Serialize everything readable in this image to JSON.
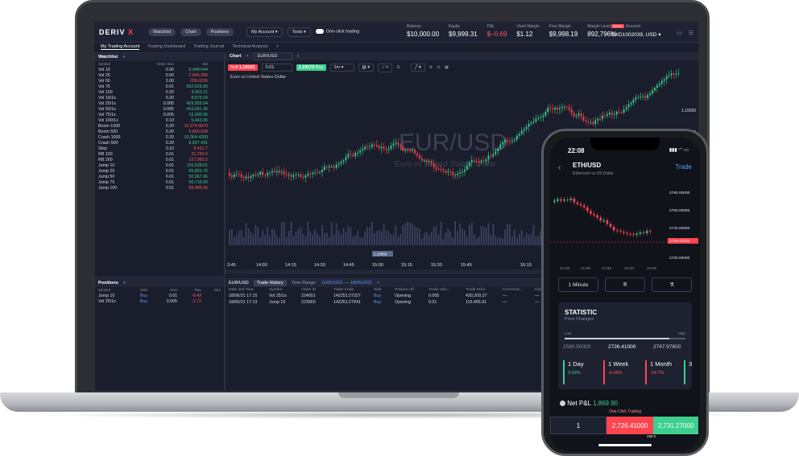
{
  "laptop": {
    "logo_main": "DERIV",
    "logo_x": "X",
    "nav_pills": [
      "Watchlist",
      "Chart",
      "Positions"
    ],
    "account_dd": "My Account",
    "tools_dd": "Tools",
    "one_click": "One-click trading",
    "stats": [
      {
        "label": "Balance",
        "value": "$10,000.00",
        "neg": false
      },
      {
        "label": "Equity",
        "value": "$9,999.31",
        "neg": false
      },
      {
        "label": "P&L",
        "value": "$−0.69",
        "neg": true
      },
      {
        "label": "Used Margin",
        "value": "$1.12",
        "neg": false
      },
      {
        "label": "Free Margin",
        "value": "$9,998.19",
        "neg": false
      },
      {
        "label": "Margin Level, %",
        "value": "892,796%",
        "neg": false
      }
    ],
    "account": {
      "badge": "DEMO",
      "label": "Account",
      "value": "DXD1002039, USD"
    },
    "tabs": [
      "My Trading Account",
      "Trading Dashboard",
      "Trading Journal",
      "Technical Analysis"
    ],
    "watchlist": {
      "title": "Watchlist",
      "cols": [
        "Symbol",
        "Order Size",
        "Bid"
      ],
      "rows": [
        {
          "s": "Vol 10",
          "o": "0.30",
          "b": "6,448.644",
          "c": "pos"
        },
        {
          "s": "Vol 25",
          "o": "0.50",
          "b": "2,646.286",
          "c": "neg"
        },
        {
          "s": "Vol 50",
          "o": "3.00",
          "b": "209.0235",
          "c": "neg"
        },
        {
          "s": "Vol 75",
          "o": "0.01",
          "b": "592,525.83",
          "c": "pos"
        },
        {
          "s": "Vol 100",
          "o": "0.20",
          "b": "4,363.21",
          "c": "pos"
        },
        {
          "s": "Vol 10/1s",
          "o": "0.20",
          "b": "8,875.54",
          "c": "pos"
        },
        {
          "s": "Vol 25/1s",
          "o": "0.005",
          "b": "429,959.04",
          "c": "pos"
        },
        {
          "s": "Vol 50/1s",
          "o": "0.005",
          "b": "419,091.36",
          "c": "pos"
        },
        {
          "s": "Vol 75/1s",
          "o": "0.005",
          "b": "15,390.95",
          "c": "pos"
        },
        {
          "s": "Vol 100/1s",
          "o": "0.10",
          "b": "5,443.96",
          "c": "pos"
        },
        {
          "s": "Boom 1000",
          "o": "0.20",
          "b": "10,374.5870",
          "c": "neg"
        },
        {
          "s": "Boom 500",
          "o": "0.20",
          "b": "5,650.638",
          "c": "neg"
        },
        {
          "s": "Crash 1000",
          "o": "0.20",
          "b": "10,064.4209",
          "c": "pos"
        },
        {
          "s": "Crash 500",
          "o": "0.20",
          "b": "8,627.431",
          "c": "pos"
        },
        {
          "s": "Step",
          "o": "0.10",
          "b": "8,431.7",
          "c": "neg"
        },
        {
          "s": "RB 100",
          "o": "0.01",
          "b": "21,793.5",
          "c": "neg"
        },
        {
          "s": "RB 200",
          "o": "0.01",
          "b": "127,092.5",
          "c": "neg"
        },
        {
          "s": "Jump 10",
          "o": "0.01",
          "b": "115,528.61",
          "c": "pos"
        },
        {
          "s": "Jump 25",
          "o": "0.01",
          "b": "95,853.76",
          "c": "pos"
        },
        {
          "s": "Jump 50",
          "o": "0.01",
          "b": "50,367.66",
          "c": "pos"
        },
        {
          "s": "Jump 75",
          "o": "0.01",
          "b": "66,710.00",
          "c": "pos"
        },
        {
          "s": "Jump 100",
          "o": "0.01",
          "b": "89,986.56",
          "c": "neg"
        }
      ]
    },
    "chart": {
      "title": "Chart",
      "symbol": "EUR/USD",
      "sell_label": "Sell",
      "sell_price": "1.19161",
      "qty": "0.01",
      "buy_price": "1.19175",
      "buy_label": "Buy",
      "tf": "1m",
      "desc": "Euro vs United States Dollar",
      "watermark": "EUR/USD",
      "watermark_sub": "Euro vs United States Dollar",
      "price_ticks": [
        "1.19250",
        "1.19200",
        "1.19161",
        "1.19150"
      ],
      "cursor_tag": "1.19050",
      "time_ticks": [
        "3:45",
        "14:00",
        "14:15",
        "14:30",
        "14:45",
        "15:00",
        "15:15",
        "15:30",
        "15:45",
        "16:15"
      ]
    },
    "positions": {
      "title": "Positions",
      "cols": [
        "Symbol",
        "Side",
        "Size",
        "P&L",
        "Stra"
      ],
      "rows": [
        {
          "s": "Jump 10",
          "side": "Buy",
          "size": "0.01",
          "pl": "-0.43"
        },
        {
          "s": "Vol 25/1s",
          "side": "Buy",
          "size": "0.005",
          "pl": "-1.72"
        }
      ]
    },
    "history": {
      "symbol_tab": "EUR/USD",
      "tab": "Trade History",
      "range_label": "Time Range:",
      "range_value": "11/06/2021 — 18/06/2021",
      "cols": [
        "Date and Time",
        "Symbol",
        "Order ID",
        "Trade Code",
        "Side",
        "Position eff...",
        "Trade Volu...",
        "Trade Price",
        "Commissi...",
        "Closed P..."
      ],
      "rows": [
        {
          "dt": "18/06/21 17:15",
          "sym": "Vol 25/1s",
          "oid": "224001",
          "tc": "142251:27327",
          "side": "Buy",
          "pe": "Opening",
          "tv": "0.005",
          "tp": "430,209.37",
          "cm": "—",
          "cp": "—"
        },
        {
          "dt": "18/06/21 17:13",
          "sym": "Jump 10",
          "oid": "223660",
          "tc": "142251:27041",
          "side": "Buy",
          "pe": "Opening",
          "tv": "0.01",
          "tp": "115,466.91",
          "cm": "—",
          "cp": "—"
        }
      ]
    }
  },
  "phone": {
    "time": "22:08",
    "symbol": "ETH/USD",
    "subtitle": "Ethereum vs US Dollar",
    "trade_label": "Trade",
    "price_ticks": [
      "2760.00000",
      "2750.00000",
      "2740.00000",
      "2726.41000",
      "2720.00000"
    ],
    "time_ticks": [
      "21:45",
      "21:50",
      "21:55",
      "22:00",
      "22:05"
    ],
    "interval": "1 Minute",
    "stat_title": "STATISTIC",
    "stat_sub": "Price Changes",
    "low_label": "Low",
    "high_label": "High",
    "low": "2580.50000",
    "current": "2726.41000",
    "high": "2747.97600",
    "cards": [
      {
        "label": "1 Day",
        "pct": "3.69%",
        "neg": false
      },
      {
        "label": "1 Week",
        "pct": "-6.45%",
        "neg": true
      },
      {
        "label": "1 Month",
        "pct": "-14.7%",
        "neg": true
      },
      {
        "label": "3",
        "pct": "",
        "neg": false
      }
    ],
    "pnl_label": "Net P&L",
    "pnl_value": "1,869.90",
    "one_click": "One-Click Trading",
    "qty": "1",
    "sell_price": "2,726.41000",
    "buy_price": "2,731.27000",
    "spread": "488.0"
  },
  "colors": {
    "up": "#3dcf8e",
    "down": "#ff444f",
    "accent": "#5d9bff"
  },
  "icons": [
    "search-icon",
    "settings-icon",
    "close-icon",
    "chevron-down-icon",
    "back-arrow-icon",
    "candles-icon",
    "flask-icon",
    "wifi-icon",
    "battery-icon"
  ]
}
